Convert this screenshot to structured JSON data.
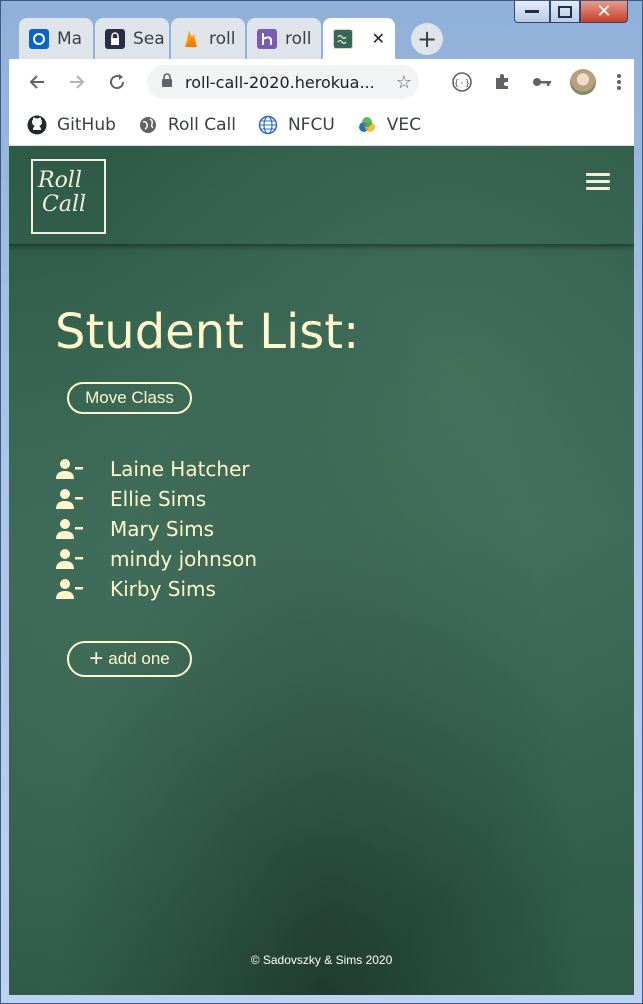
{
  "browser": {
    "tabs": [
      {
        "label": "Ma",
        "icon": "outlook-icon",
        "color": "#0a64c8"
      },
      {
        "label": "Sea",
        "icon": "lock-app-icon",
        "color": "#2a2f45"
      },
      {
        "label": "roll",
        "icon": "firebase-icon",
        "color": "#ffa000"
      },
      {
        "label": "roll",
        "icon": "heroku-icon",
        "color": "#7a5bb5"
      }
    ],
    "active_tab": {
      "icon": "roll-call-favicon",
      "close_label": "✕"
    },
    "new_tab_label": "+",
    "url": "roll-call-2020.herokua...",
    "bookmarks": [
      {
        "label": "GitHub",
        "icon": "github-icon"
      },
      {
        "label": "Roll Call",
        "icon": "globe-icon"
      },
      {
        "label": "NFCU",
        "icon": "globe-grid-icon"
      },
      {
        "label": "VEC",
        "icon": "vec-icon"
      }
    ]
  },
  "app": {
    "logo_line1": "Roll",
    "logo_line2": "Call",
    "page_title": "Student List:",
    "move_class_label": "Move Class",
    "students": [
      "Laine Hatcher",
      "Ellie Sims",
      "Mary Sims",
      "mindy johnson",
      "Kirby Sims"
    ],
    "add_label": "add one",
    "footer": "© Sadovszky & Sims 2020",
    "colors": {
      "chalk": "#fff8cc",
      "board": "#2f5a48"
    }
  }
}
